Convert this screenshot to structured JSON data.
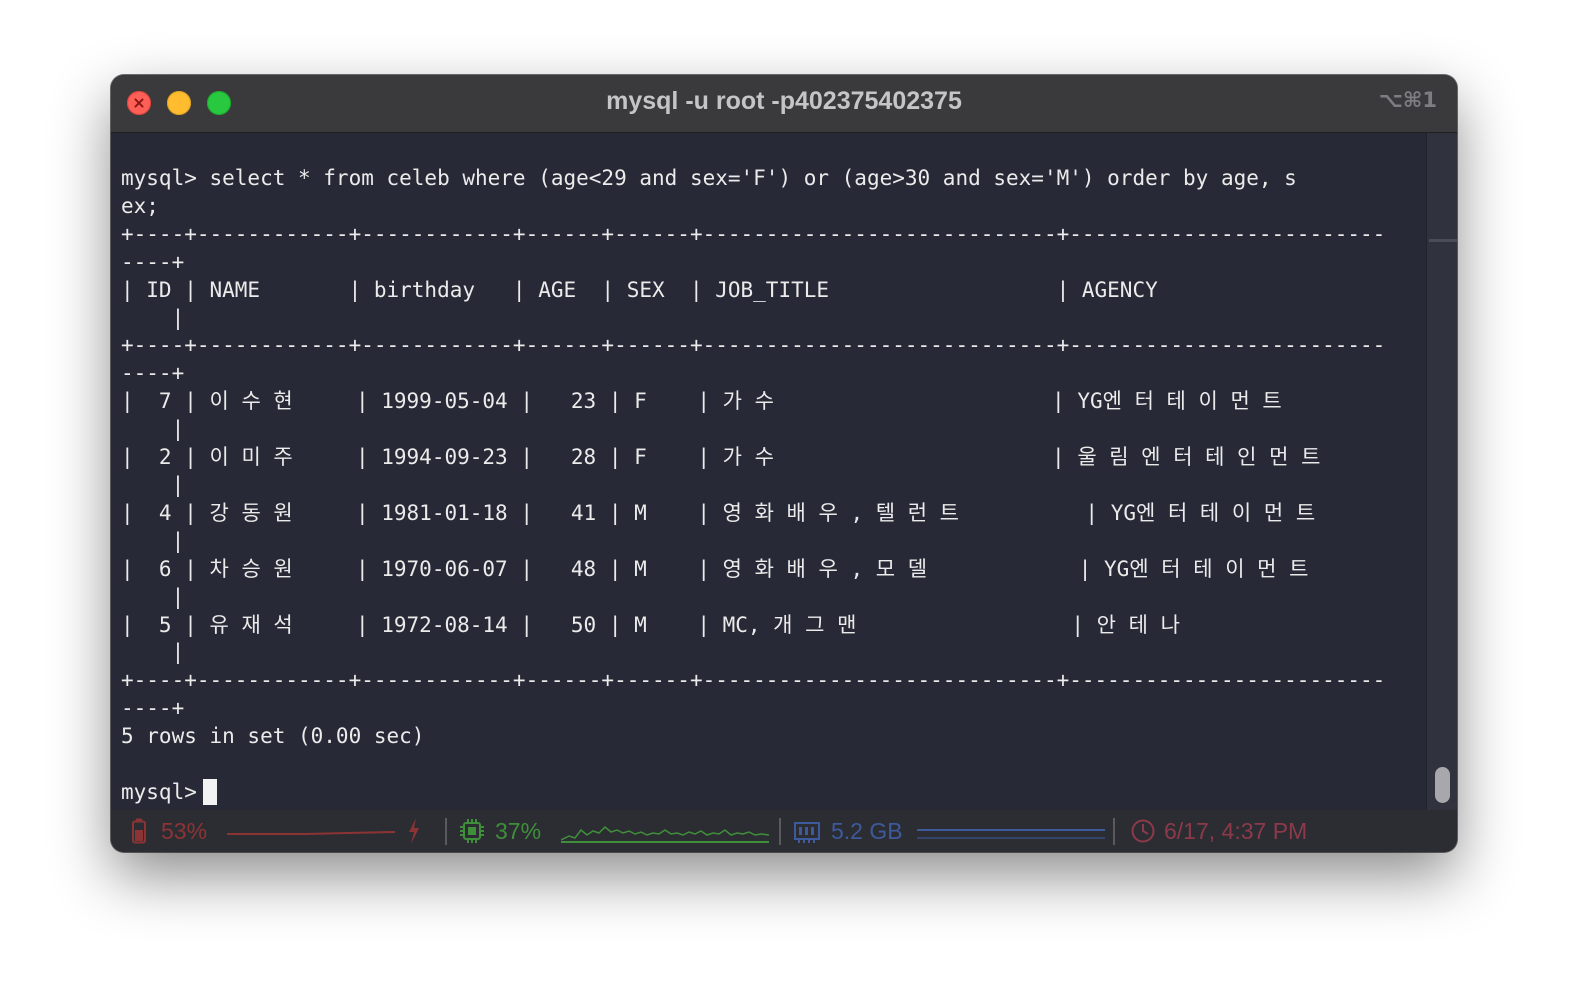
{
  "window": {
    "title": "mysql -u root -p402375402375",
    "shortcut": "⌥⌘1"
  },
  "terminal": {
    "lines": [
      "mysql> select * from celeb where (age<29 and sex='F') or (age>30 and sex='M') order by age, s",
      "ex;",
      "+----+------------+------------+------+------+----------------------------+-------------------------",
      "----+",
      "| ID | NAME       | birthday   | AGE  | SEX  | JOB_TITLE                  | AGENCY",
      "    |",
      "+----+------------+------------+------+------+----------------------------+-------------------------",
      "----+",
      "|  7 | 이 수 현     | 1999-05-04 |   23 | F    | 가 수                      | YG엔 터 테 이 먼 트",
      "    |",
      "|  2 | 이 미 주     | 1994-09-23 |   28 | F    | 가 수                      | 울 림 엔 터 테 인 먼 트",
      "    |",
      "|  4 | 강 동 원     | 1981-01-18 |   41 | M    | 영 화 배 우 , 텔 런 트          | YG엔 터 테 이 먼 트",
      "    |",
      "|  6 | 차 승 원     | 1970-06-07 |   48 | M    | 영 화 배 우 , 모 델            | YG엔 터 테 이 먼 트",
      "    |",
      "|  5 | 유 재 석     | 1972-08-14 |   50 | M    | MC, 개 그 맨                 | 안 테 나",
      "    |",
      "+----+------------+------------+------+------+----------------------------+-------------------------",
      "----+",
      "5 rows in set (0.00 sec)",
      "",
      "mysql> "
    ],
    "prompt": "mysql>"
  },
  "statusbar": {
    "battery": {
      "value": "53%",
      "color": "#8c3434",
      "icon": "battery-icon",
      "charge_icon": "lightning-icon"
    },
    "cpu": {
      "value": "37%",
      "color": "#3f8f3a",
      "icon": "cpu-chip-icon"
    },
    "memory": {
      "value": "5.2 GB",
      "color": "#3d5a9c",
      "icon": "memory-icon"
    },
    "clock": {
      "value": "6/17, 4:37 PM",
      "color": "#8c3a4a",
      "icon": "clock-icon"
    }
  }
}
